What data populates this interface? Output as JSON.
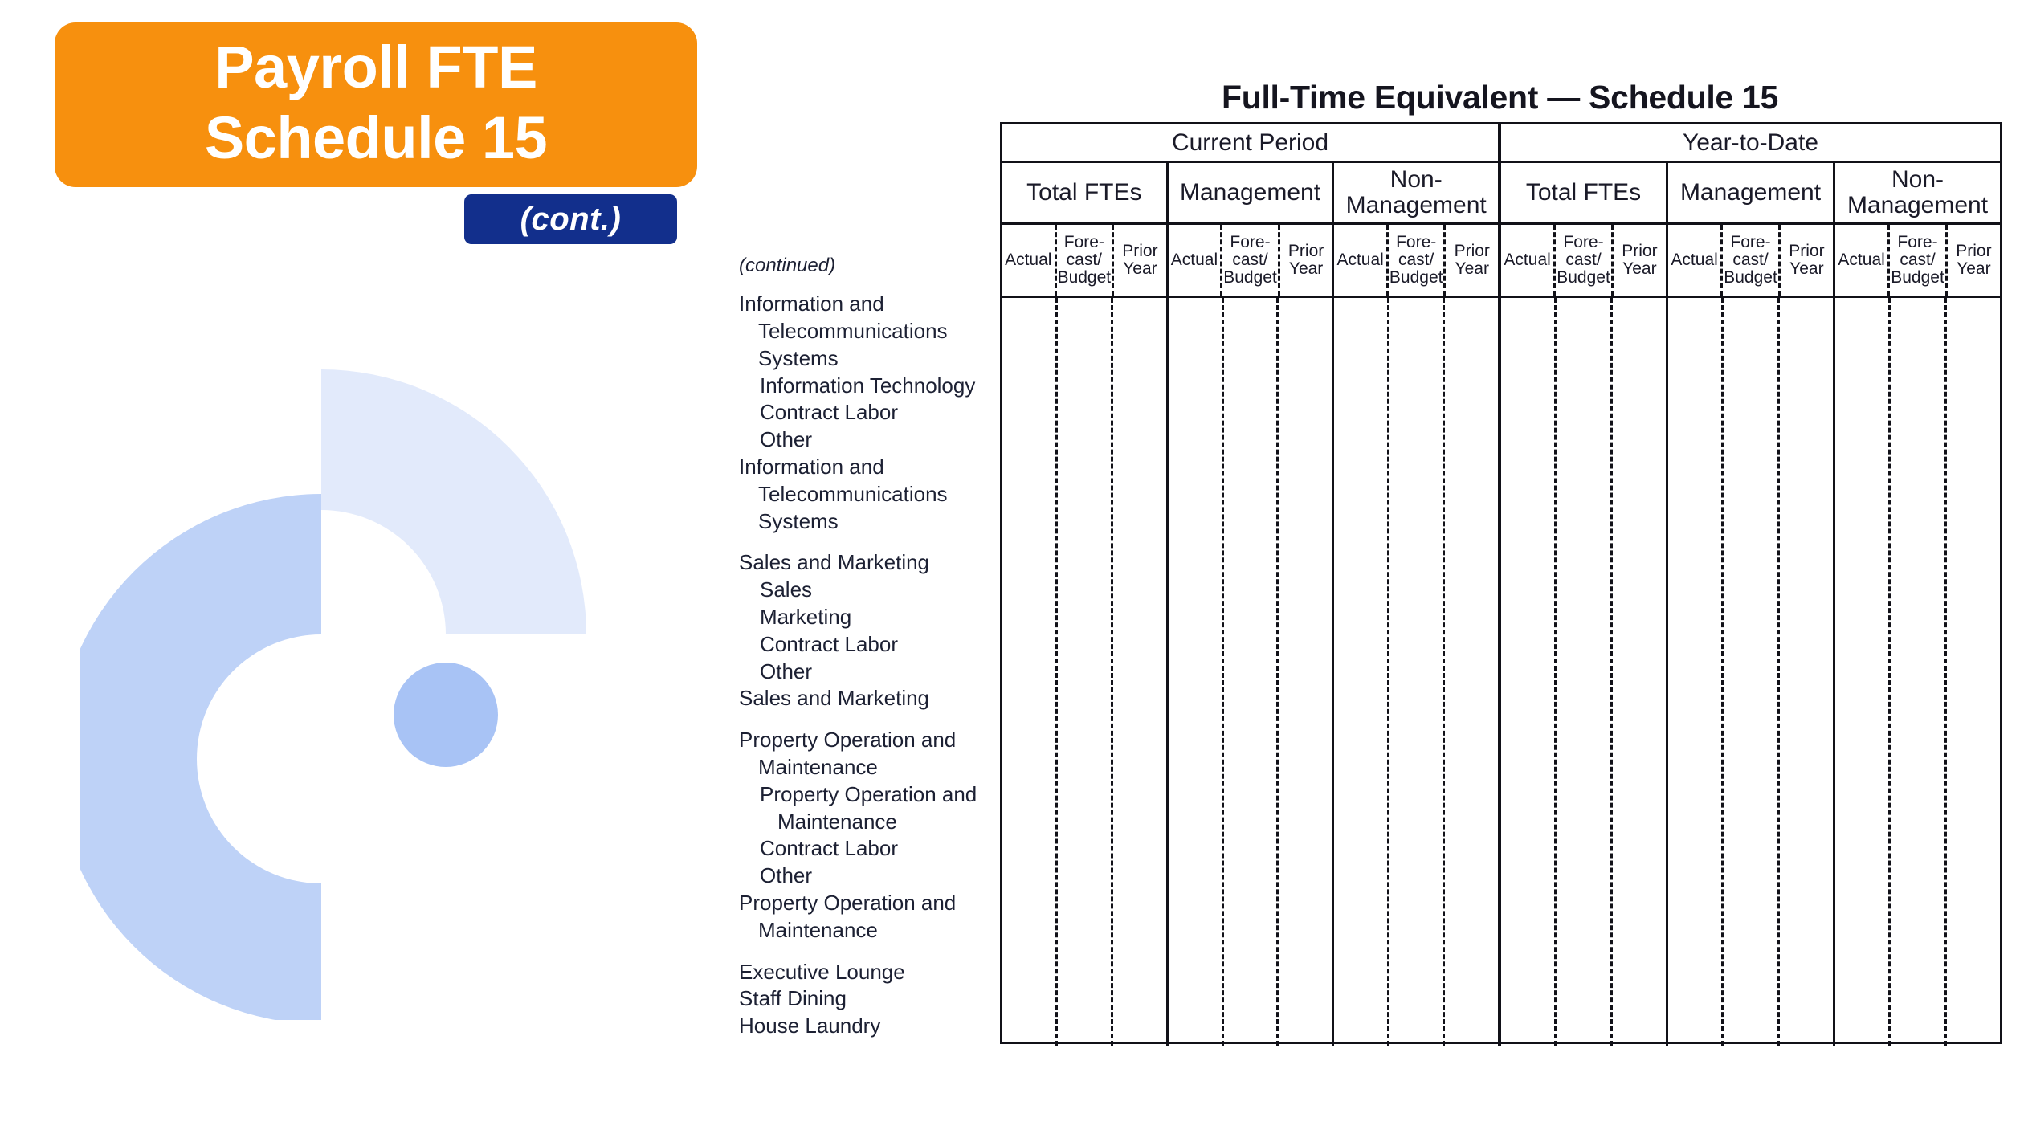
{
  "slide": {
    "title_lines": [
      "Payroll FTE",
      "Schedule 15"
    ],
    "continuation_badge": "(cont.)",
    "banner_color": "#F7900E",
    "badge_color": "#122F8C",
    "logo_arc_outer_color": "#E2EAFB",
    "logo_arc_inner_color": "#BED2F7",
    "logo_dot_color": "#A8C3F5"
  },
  "schedule": {
    "title": "Full-Time Equivalent — Schedule 15",
    "continued_note": "(continued)",
    "periods": [
      {
        "name": "Current Period",
        "groups": [
          {
            "name": "Total FTEs",
            "columns": [
              "Actual",
              "Fore-cast/ Budget",
              "Prior Year"
            ]
          },
          {
            "name": "Management",
            "columns": [
              "Actual",
              "Fore-cast/ Budget",
              "Prior Year"
            ]
          },
          {
            "name": "Non-Management",
            "columns": [
              "Actual",
              "Fore-cast/ Budget",
              "Prior Year"
            ]
          }
        ]
      },
      {
        "name": "Year-to-Date",
        "groups": [
          {
            "name": "Total FTEs",
            "columns": [
              "Actual",
              "Fore-cast/ Budget",
              "Prior Year"
            ]
          },
          {
            "name": "Management",
            "columns": [
              "Actual",
              "Fore-cast/ Budget",
              "Prior Year"
            ]
          },
          {
            "name": "Non-Management",
            "columns": [
              "Actual",
              "Fore-cast/ Budget",
              "Prior Year"
            ]
          }
        ]
      }
    ],
    "row_blocks": [
      {
        "rows": [
          {
            "label": "Information and Telecommunications Systems",
            "level": 0,
            "wrap": true
          },
          {
            "label": "Information Technology",
            "level": 1,
            "wrap": false
          },
          {
            "label": "Contract Labor",
            "level": 1,
            "wrap": false
          },
          {
            "label": "Other",
            "level": 1,
            "wrap": false
          },
          {
            "label": "Information and Telecommunications Systems",
            "level": 0,
            "wrap": true
          }
        ]
      },
      {
        "rows": [
          {
            "label": "Sales and Marketing",
            "level": 0,
            "wrap": false
          },
          {
            "label": "Sales",
            "level": 1,
            "wrap": false
          },
          {
            "label": "Marketing",
            "level": 1,
            "wrap": false
          },
          {
            "label": "Contract Labor",
            "level": 1,
            "wrap": false
          },
          {
            "label": "Other",
            "level": 1,
            "wrap": false
          },
          {
            "label": "Sales and Marketing",
            "level": 0,
            "wrap": false
          }
        ]
      },
      {
        "rows": [
          {
            "label": "Property Operation and Maintenance",
            "level": 0,
            "wrap": true
          },
          {
            "label": "Property Operation and Maintenance",
            "level": 1,
            "wrap": true
          },
          {
            "label": "Contract Labor",
            "level": 1,
            "wrap": false
          },
          {
            "label": "Other",
            "level": 1,
            "wrap": false
          },
          {
            "label": "Property Operation and Maintenance",
            "level": 0,
            "wrap": true
          }
        ]
      },
      {
        "rows": [
          {
            "label": "Executive Lounge",
            "level": 0,
            "wrap": false
          },
          {
            "label": "Staff Dining",
            "level": 0,
            "wrap": false
          },
          {
            "label": "House Laundry",
            "level": 0,
            "wrap": false
          }
        ]
      }
    ]
  }
}
